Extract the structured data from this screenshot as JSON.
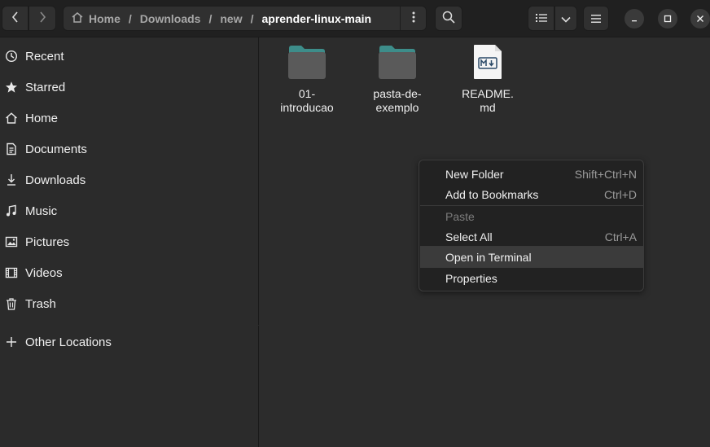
{
  "header": {
    "breadcrumbs": [
      "Home",
      "Downloads",
      "new",
      "aprender-linux-main"
    ],
    "separator": "/"
  },
  "sidebar": {
    "items": [
      {
        "label": "Recent",
        "icon": "clock-icon"
      },
      {
        "label": "Starred",
        "icon": "star-icon"
      },
      {
        "label": "Home",
        "icon": "home-icon"
      },
      {
        "label": "Documents",
        "icon": "document-icon"
      },
      {
        "label": "Downloads",
        "icon": "download-icon"
      },
      {
        "label": "Music",
        "icon": "music-icon"
      },
      {
        "label": "Pictures",
        "icon": "picture-icon"
      },
      {
        "label": "Videos",
        "icon": "video-icon"
      },
      {
        "label": "Trash",
        "icon": "trash-icon"
      },
      {
        "label": "Other Locations",
        "icon": "plus-icon"
      }
    ]
  },
  "files": [
    {
      "name_line1": "01-",
      "name_line2": "introducao",
      "icon": "folder-icon"
    },
    {
      "name_line1": "pasta-de-",
      "name_line2": "exemplo",
      "icon": "folder-icon"
    },
    {
      "name_line1": "README.",
      "name_line2": "md",
      "icon": "markdown-file-icon"
    }
  ],
  "context_menu": {
    "items": [
      {
        "label": "New Folder",
        "accel": "Shift+Ctrl+N"
      },
      {
        "label": "Add to Bookmarks",
        "accel": "Ctrl+D"
      },
      {
        "label": "Paste",
        "accel": ""
      },
      {
        "label": "Select All",
        "accel": "Ctrl+A"
      },
      {
        "label": "Open in Terminal",
        "accel": ""
      },
      {
        "label": "Properties",
        "accel": ""
      }
    ]
  },
  "colors": {
    "headerbar": "#202020",
    "sidebar": "#2b2b2b",
    "content": "#2c2c2c",
    "folder_tab": "#3d8d8a",
    "folder_body": "#5a5a5a",
    "menu_bg": "#222222",
    "menu_hover": "#3b3b3b"
  }
}
